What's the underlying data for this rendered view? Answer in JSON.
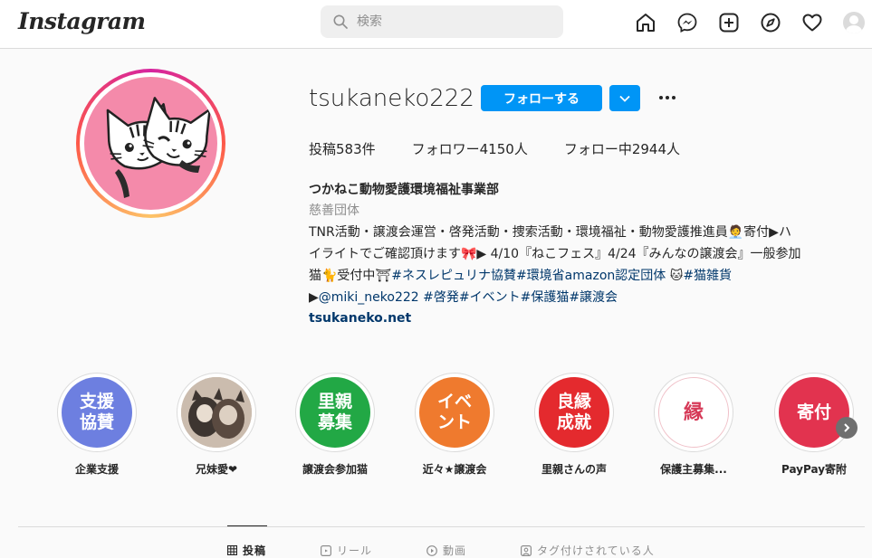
{
  "header": {
    "logo": "Instagram",
    "search_placeholder": "検索"
  },
  "profile": {
    "username": "tsukaneko222",
    "follow_label": "フォローする",
    "stats": {
      "posts": "投稿583件",
      "followers": "フォロワー4150人",
      "following": "フォロー中2944人"
    },
    "display_name": "つかねこ動物愛護環境福祉事業部",
    "category": "慈善団体",
    "bio": {
      "line1": "TNR活動・譲渡会運営・啓発活動・捜索活動・環境福祉・動物愛護推進員🧑‍💼寄付▶ハ",
      "line2": "イライトでご確認頂けます🎀▶ 4/10『ねこフェス』4/24『みんなの譲渡会』一般参加",
      "line3_a": "猫🐈受付中⛩",
      "line3_b": "#ネスレピュリナ協賛#環境省amazon認定団体",
      "line3_c": " 🐱",
      "line3_d": "#猫雑貨",
      "line4_a": "▶",
      "line4_b": "@miki_neko222 #啓発#イベント#保護猫#譲渡会"
    },
    "link": "tsukaneko.net"
  },
  "highlights": [
    {
      "label": "企業支援",
      "circle_text": "支援\n協賛",
      "color": "#6d7fe0"
    },
    {
      "label": "兄妹愛❤",
      "circle_text": "",
      "color": "#b9a89a"
    },
    {
      "label": "譲渡会参加猫",
      "circle_text": "里親\n募集",
      "color": "#22a845"
    },
    {
      "label": "近々★譲渡会",
      "circle_text": "イベ\nント",
      "color": "#ef7a2e"
    },
    {
      "label": "里親さんの声",
      "circle_text": "良縁\n成就",
      "color": "#e42a2e"
    },
    {
      "label": "保護主募集...",
      "circle_text": "縁",
      "color": "#ffffff"
    },
    {
      "label": "PayPay寄附",
      "circle_text": "寄付",
      "color": "#e2334f"
    }
  ],
  "tabs": [
    {
      "label": "投稿",
      "icon": "grid-icon"
    },
    {
      "label": "リール",
      "icon": "reels-icon"
    },
    {
      "label": "動画",
      "icon": "video-icon"
    },
    {
      "label": "タグ付けされている人",
      "icon": "tagged-icon"
    }
  ]
}
